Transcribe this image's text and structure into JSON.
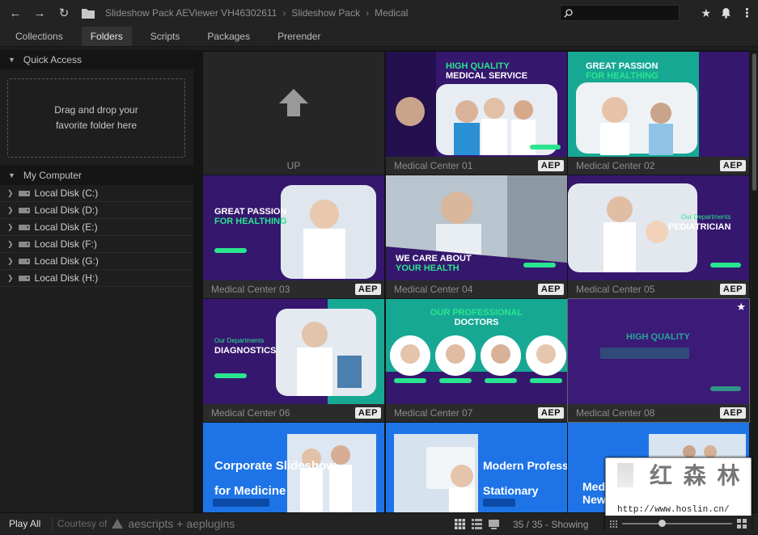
{
  "header": {
    "breadcrumbs": [
      "Slideshow Pack AEViewer VH46302611",
      "Slideshow Pack",
      "Medical"
    ],
    "search_placeholder": ""
  },
  "tabs": [
    {
      "label": "Collections"
    },
    {
      "label": "Folders",
      "active": true
    },
    {
      "label": "Scripts"
    },
    {
      "label": "Packages"
    },
    {
      "label": "Prerender"
    }
  ],
  "sidebar": {
    "quick_access": "Quick Access",
    "drop_text": "Drag and drop your favorite folder here",
    "my_computer": "My Computer",
    "disks": [
      "Local Disk (C:)",
      "Local Disk (D:)",
      "Local Disk (E:)",
      "Local Disk (F:)",
      "Local Disk (G:)",
      "Local Disk (H:)"
    ]
  },
  "grid": {
    "up_label": "UP",
    "badge": "AEP",
    "items": [
      {
        "label": "Medical Center 01",
        "l1": "HIGH QUALITY",
        "l2": "MEDICAL SERVICE"
      },
      {
        "label": "Medical Center 02",
        "l1": "GREAT PASSION",
        "l2": "FOR HEALTHING"
      },
      {
        "label": "Medical Center 03",
        "l1": "GREAT PASSION",
        "l2": "FOR HEALTHING"
      },
      {
        "label": "Medical Center 04",
        "l1": "WE CARE ABOUT",
        "l2": "YOUR HEALTH"
      },
      {
        "label": "Medical Center 05",
        "l1": "Our Departments",
        "l2": "PEDIATRICIAN"
      },
      {
        "label": "Medical Center 06",
        "l1": "Our Departments",
        "l2": "DIAGNOSTICS"
      },
      {
        "label": "Medical Center 07",
        "l1": "OUR PROFESSIONAL",
        "l2": "DOCTORS"
      },
      {
        "label": "Medical Center 08",
        "l1": "HIGH QUALITY",
        "l2": ""
      },
      {
        "label": "",
        "l1": "Corporate Slideshow",
        "l2": "for Medicine"
      },
      {
        "label": "",
        "l1": "Modern Professional",
        "l2": "Stationary"
      },
      {
        "label": "",
        "l1": "Medical",
        "l2": "New Project"
      }
    ]
  },
  "status": {
    "play_all": "Play All",
    "courtesy": "Courtesy of",
    "brand": "aescripts + aeplugins",
    "count": "35 / 35 - Showing"
  },
  "watermark": {
    "cn": "红 森 林",
    "url": "http://www.hoslin.cn/"
  },
  "colors": {
    "purple": "#3b1a78",
    "teal": "#1fc9a8",
    "green": "#29e58f",
    "blue": "#1e74e6"
  }
}
